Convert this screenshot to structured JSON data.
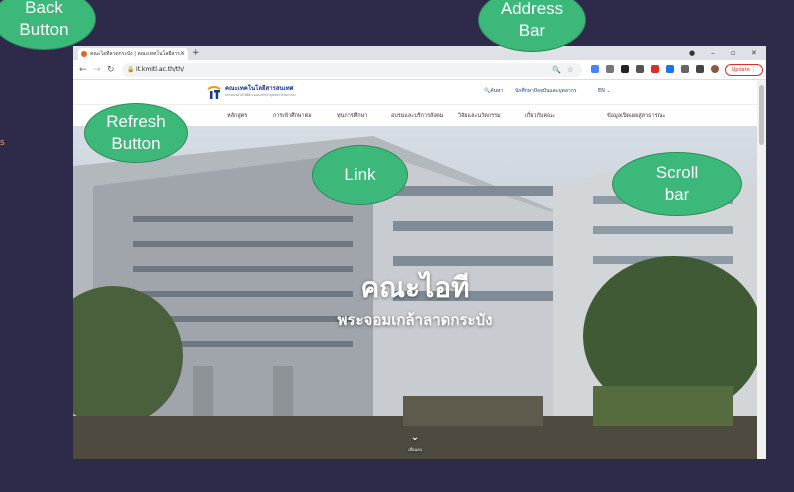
{
  "browser": {
    "tab_title": "คณะไอทีลาดกระบัง | คณะเทคโนโลยีสาร...",
    "address": "it.kmitl.ac.th/th/",
    "update_label": "Update"
  },
  "site": {
    "logo_name": "คณะเทคโนโลยีสารสนเทศ",
    "logo_sub": "สถาบันเทคโนโลยีพระจอมเกล้าเจ้าคุณทหารลาดกระบัง",
    "search_label": "ค้นหา",
    "audience_link": "นักศึกษาปัจจุบันและบุคลากร",
    "lang": "EN",
    "menu": [
      "หลักสูตร",
      "การเข้าศึกษาต่อ",
      "ทุนการศึกษา",
      "อบรมและบริการสังคม",
      "วิจัยและนวัตกรรม",
      "เกี่ยวกับคณะ",
      "ข้อมูลเปิดเผยสู่สาธารณะ"
    ],
    "hero_title": "คณะไอที",
    "hero_subtitle": "พระจอมเกล้าลาดกระบัง",
    "scroll_hint": "เลื่อนลง"
  },
  "annotations": {
    "back": [
      "Back",
      "Button"
    ],
    "address": [
      "Address",
      "Bar"
    ],
    "refresh": [
      "Refresh",
      "Button"
    ],
    "link": [
      "Link"
    ],
    "scroll": [
      "Scroll",
      "bar"
    ]
  },
  "colors": {
    "callout": "#3cb97a",
    "background": "#2e2a4a",
    "brand": "#1b3b8a"
  }
}
